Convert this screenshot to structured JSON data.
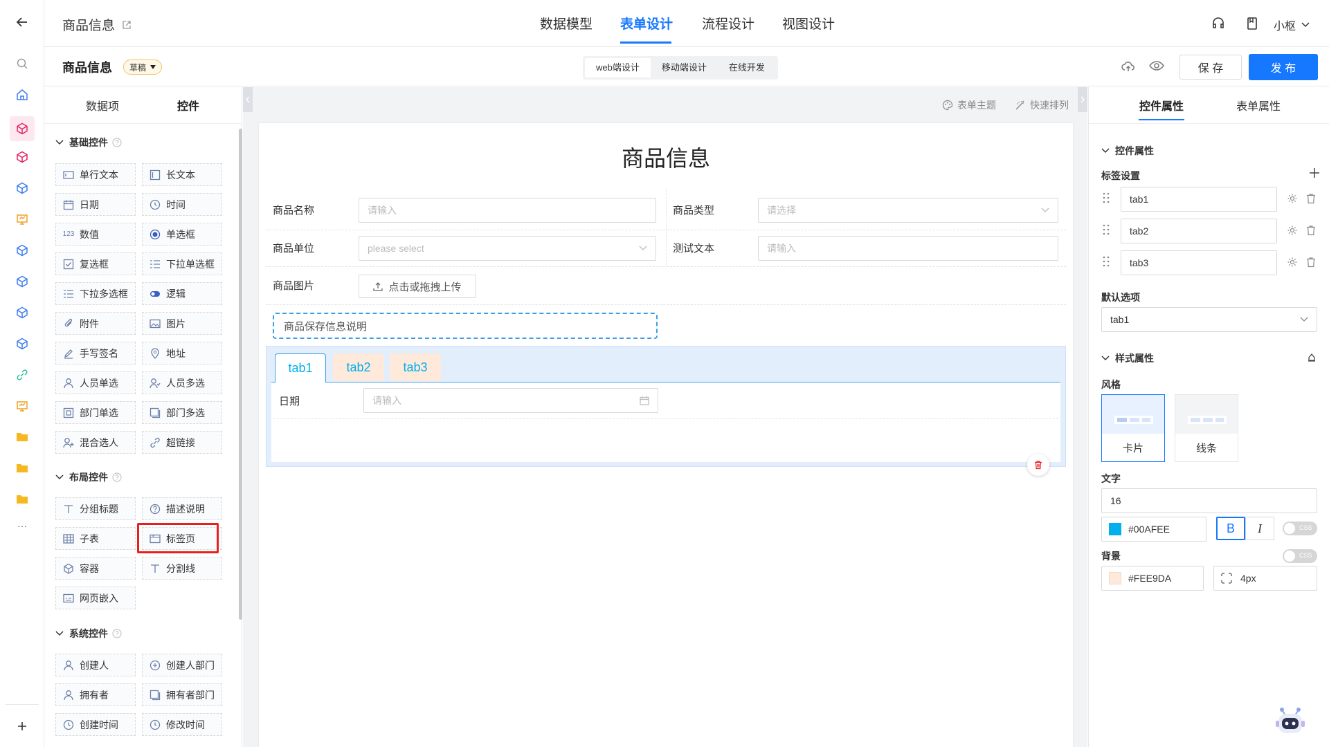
{
  "header": {
    "app_title": "商品信息",
    "nav_tabs": [
      "数据模型",
      "表单设计",
      "流程设计",
      "视图设计"
    ],
    "active_tab": "表单设计",
    "user_name": "小枢"
  },
  "subbar": {
    "form_name": "商品信息",
    "status_badge": "草稿",
    "modes": [
      "web端设计",
      "移动端设计",
      "在线开发"
    ],
    "save_label": "保 存",
    "publish_label": "发 布"
  },
  "left_panel": {
    "tabs": [
      "数据项",
      "控件"
    ],
    "groups": {
      "basic": "基础控件",
      "layout": "布局控件",
      "system": "系统控件"
    },
    "basic_controls": [
      "单行文本",
      "长文本",
      "日期",
      "时间",
      "数值",
      "单选框",
      "复选框",
      "下拉单选框",
      "下拉多选框",
      "逻辑",
      "附件",
      "图片",
      "手写签名",
      "地址",
      "人员单选",
      "人员多选",
      "部门单选",
      "部门多选",
      "混合选人",
      "超链接"
    ],
    "layout_controls": [
      "分组标题",
      "描述说明",
      "子表",
      "标签页",
      "容器",
      "分割线",
      "网页嵌入"
    ],
    "system_controls": [
      "创建人",
      "创建人部门",
      "拥有者",
      "拥有者部门",
      "创建时间",
      "修改时间"
    ]
  },
  "canvas": {
    "toolbar": [
      "表单主题",
      "快速排列"
    ],
    "form_title": "商品信息",
    "fields": {
      "name_label": "商品名称",
      "name_placeholder": "请输入",
      "type_label": "商品类型",
      "type_placeholder": "请选择",
      "unit_label": "商品单位",
      "unit_placeholder": "please select",
      "test_label": "测试文本",
      "test_placeholder": "请输入",
      "image_label": "商品图片",
      "upload_label": "点击或拖拽上传",
      "description": "商品保存信息说明"
    },
    "tabs": [
      "tab1",
      "tab2",
      "tab3"
    ],
    "tab_field_label": "日期",
    "tab_field_placeholder": "请输入"
  },
  "right_panel": {
    "tabs": [
      "控件属性",
      "表单属性"
    ],
    "section_control": "控件属性",
    "tag_settings_label": "标签设置",
    "tags": [
      "tab1",
      "tab2",
      "tab3"
    ],
    "default_option_label": "默认选项",
    "default_option_value": "tab1",
    "section_style": "样式属性",
    "style_label": "风格",
    "style_options": [
      "卡片",
      "线条"
    ],
    "text_label": "文字",
    "font_size": "16",
    "text_color": "#00AFEE",
    "bold_label": "B",
    "italic_label": "I",
    "css_label": "CSS",
    "background_label": "背景",
    "bg_color": "#FEE9DA",
    "radius": "4px"
  },
  "colors": {
    "accent": "#1677ff",
    "tab_text": "#00AFEE",
    "tab_bg": "#FEE9DA",
    "highlight_box": "#e8201d"
  }
}
